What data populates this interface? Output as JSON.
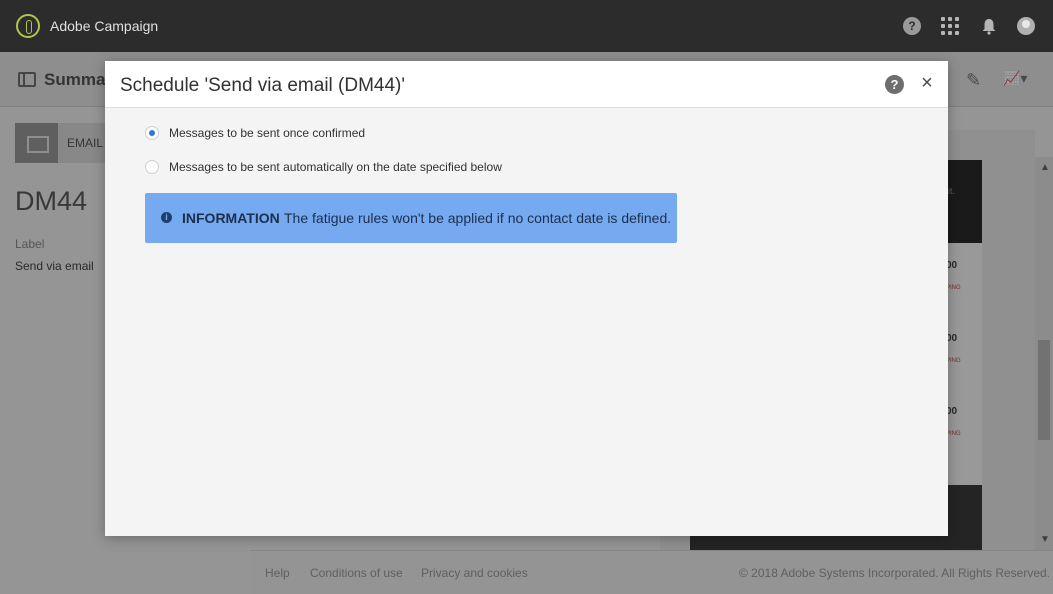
{
  "app": {
    "title": "Adobe Campaign",
    "accent": "#b3c44a"
  },
  "background_page": {
    "summary_title": "Summar",
    "badge_label": "EMAIL",
    "delivery_title": "DM44",
    "label_caption": "Label",
    "label_value": "Send via email",
    "prices": [
      "00",
      "00",
      "00"
    ],
    "tags": [
      "PING",
      "PING",
      "PING"
    ],
    "preview_snippet": "it."
  },
  "footer": {
    "links": [
      "Help",
      "Conditions of use",
      "Privacy and cookies"
    ],
    "copyright": "© 2018 Adobe Systems Incorporated. All Rights Reserved."
  },
  "modal": {
    "title": "Schedule 'Send via email (DM44)'",
    "help_glyph": "?",
    "close_glyph": "×",
    "options": [
      {
        "label": "Messages to be sent once confirmed",
        "selected": true
      },
      {
        "label": "Messages to be sent automatically on the date specified below",
        "selected": false
      }
    ],
    "info": {
      "icon_glyph": "i",
      "title": "INFORMATION",
      "text": "The fatigue rules won't be applied if no contact date is defined.",
      "color": "#75a9f0"
    }
  },
  "top_icons": {
    "help_glyph": "?"
  }
}
